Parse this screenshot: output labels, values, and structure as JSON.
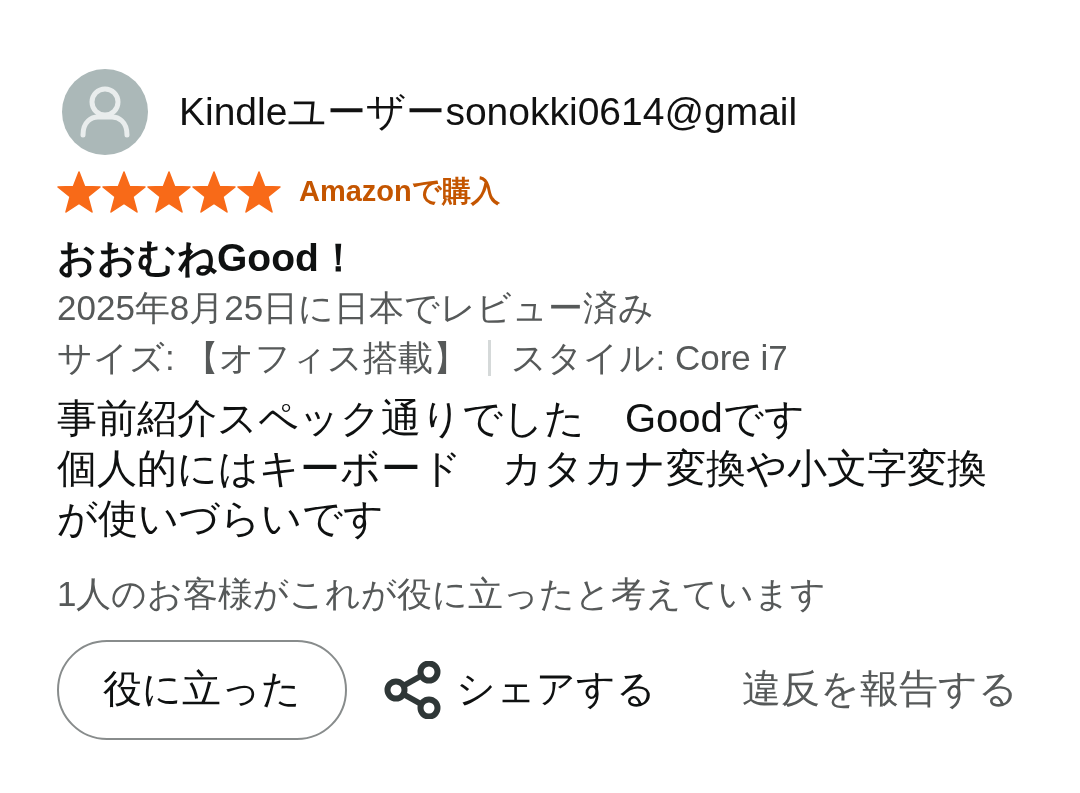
{
  "review": {
    "reviewer": {
      "name": "Kindleユーザーsonokki0614@gmail"
    },
    "stars": 5,
    "badge": "Amazonで購入",
    "title": "おおむねGood！",
    "date": "2025年8月25日に日本でレビュー済み",
    "variations": [
      "サイズ: 【オフィス搭載】",
      "スタイル: Core i7"
    ],
    "body": [
      "事前紹介スペック通りでした　Goodです",
      "個人的にはキーボード　カタカナ変換や小文字変換が使いづらいです"
    ],
    "helpful_count": "1人のお客様がこれが役に立ったと考えています",
    "actions": {
      "helpful": "役に立った",
      "share": "シェアする",
      "report": "違反を報告する"
    }
  }
}
